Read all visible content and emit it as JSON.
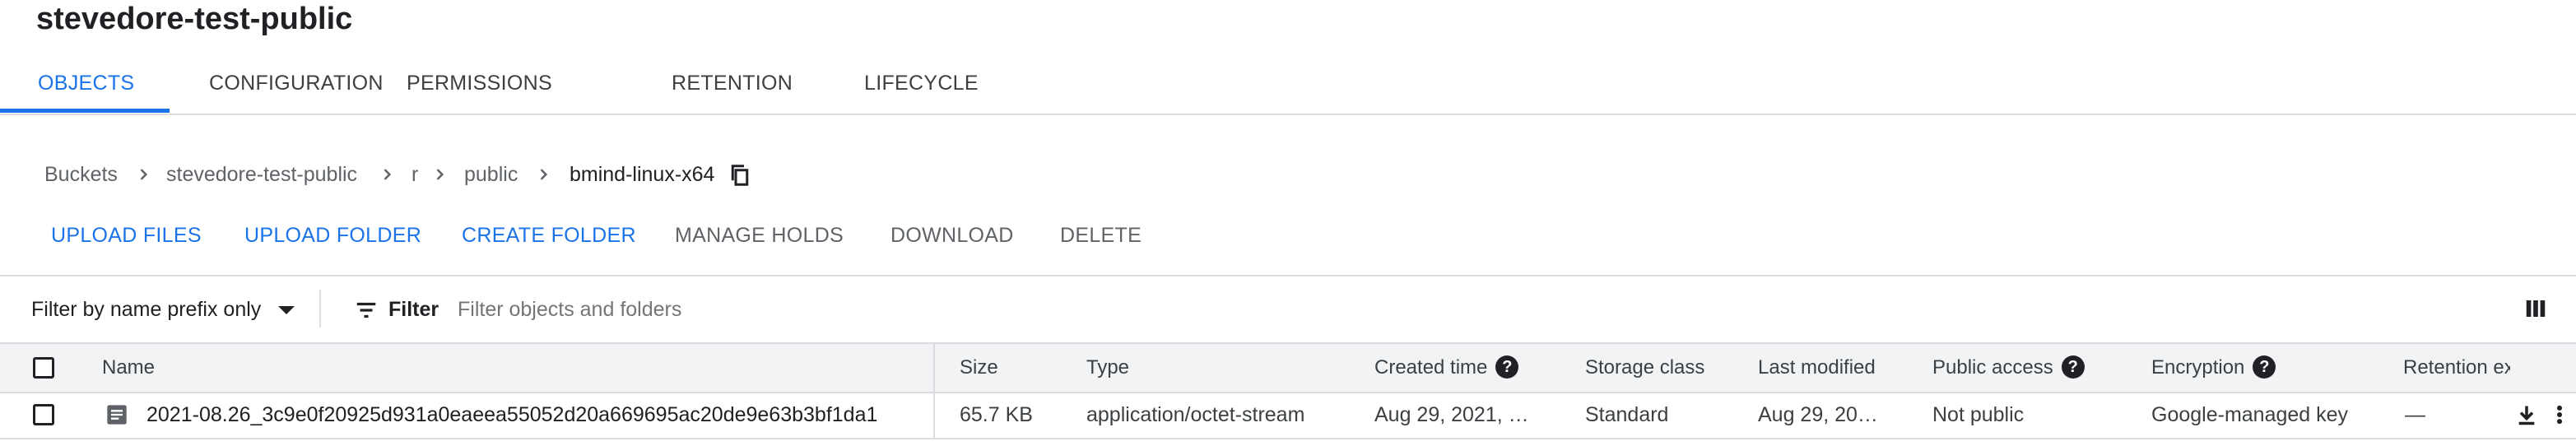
{
  "bucket": {
    "title": "stevedore-test-public"
  },
  "tabs": [
    {
      "label": "OBJECTS",
      "active": true
    },
    {
      "label": "CONFIGURATION",
      "active": false
    },
    {
      "label": "PERMISSIONS",
      "active": false
    },
    {
      "label": "RETENTION",
      "active": false
    },
    {
      "label": "LIFECYCLE",
      "active": false
    }
  ],
  "breadcrumb": {
    "items": [
      "Buckets",
      "stevedore-test-public",
      "r",
      "public",
      "bmind-linux-x64"
    ],
    "copy_icon": "copy-icon"
  },
  "actions": [
    {
      "label": "UPLOAD FILES",
      "enabled": true
    },
    {
      "label": "UPLOAD FOLDER",
      "enabled": true
    },
    {
      "label": "CREATE FOLDER",
      "enabled": true
    },
    {
      "label": "MANAGE HOLDS",
      "enabled": false
    },
    {
      "label": "DOWNLOAD",
      "enabled": false
    },
    {
      "label": "DELETE",
      "enabled": false
    }
  ],
  "filter": {
    "mode": "Filter by name prefix only",
    "label": "Filter",
    "placeholder": "Filter objects and folders"
  },
  "table": {
    "columns": [
      "Name",
      "Size",
      "Type",
      "Created time",
      "Storage class",
      "Last modified",
      "Public access",
      "Encryption",
      "Retention ex"
    ],
    "rows": [
      {
        "name": "2021-08.26_3c9e0f20925d931a0eaeea55052d20a669695ac20de9e63b3bf1da1",
        "size": "65.7 KB",
        "type": "application/octet-stream",
        "created": "Aug 29, 2021, …",
        "storage_class": "Standard",
        "modified": "Aug 29, 20…",
        "public_access": "Not public",
        "encryption": "Google-managed key",
        "retention": "—"
      }
    ]
  },
  "colors": {
    "accent": "#1a73e8",
    "divider": "#dadce0",
    "header_bg": "#f1f3f4",
    "disabled": "#5f6368"
  }
}
